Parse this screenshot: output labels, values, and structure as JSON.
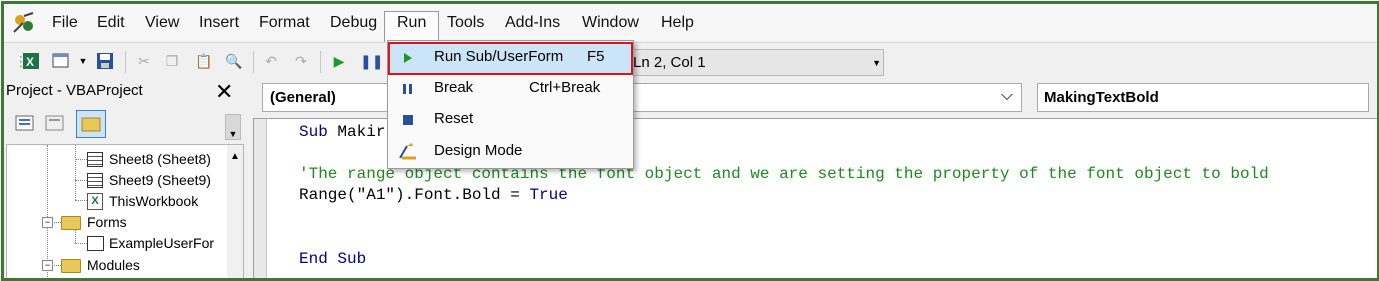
{
  "menubar": {
    "items": [
      "File",
      "Edit",
      "View",
      "Insert",
      "Format",
      "Debug",
      "Run",
      "Tools",
      "Add-Ins",
      "Window",
      "Help"
    ]
  },
  "toolbar": {
    "position": "Ln 2, Col 1"
  },
  "project": {
    "title": "Project - VBAProject",
    "close": "✕",
    "tree": [
      {
        "label": "Sheet8 (Sheet8)",
        "icon": "sheet-icon"
      },
      {
        "label": "Sheet9 (Sheet9)",
        "icon": "sheet-icon"
      },
      {
        "label": "ThisWorkbook",
        "icon": "workbook-icon"
      },
      {
        "label": "Forms",
        "icon": "folder-icon"
      },
      {
        "label": "ExampleUserFor",
        "icon": "userform-icon"
      },
      {
        "label": "Modules",
        "icon": "folder-icon"
      }
    ]
  },
  "code": {
    "object_combo": "(General)",
    "proc_combo": "MakingTextBold",
    "lines": {
      "sub_kw": "Sub",
      "sub_name": " Makir",
      "comment": "'The range object contains the font object and we are setting the property of the font object to bold",
      "stmt": "Range(\"A1\").Font.Bold = ",
      "true_kw": "True",
      "end_sub": "End Sub"
    }
  },
  "run_menu": {
    "items": [
      {
        "label": "Run Sub/UserForm",
        "shortcut": "F5",
        "icon": "run-icon",
        "highlighted": true
      },
      {
        "label": "Break",
        "shortcut": "Ctrl+Break",
        "icon": "pause-icon"
      },
      {
        "label": "Reset",
        "shortcut": "",
        "icon": "stop-icon"
      },
      {
        "label": "Design Mode",
        "shortcut": "",
        "icon": "design-mode-icon"
      }
    ]
  },
  "colors": {
    "frame_border": "#3a7a35",
    "highlight_border": "#d9141b",
    "highlight_fill": "#cce4f7",
    "comment": "#1d8a1d",
    "keyword": "#00008b"
  }
}
